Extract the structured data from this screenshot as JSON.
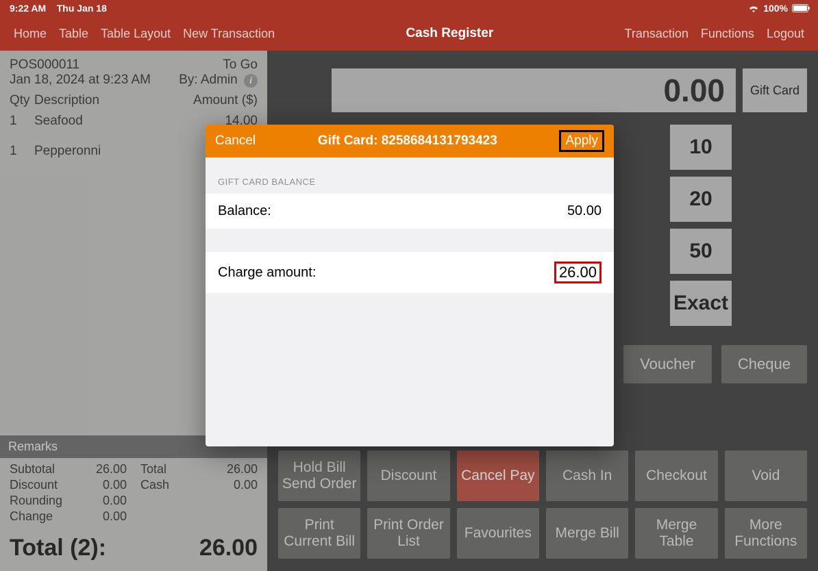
{
  "status": {
    "time": "9:22 AM",
    "date": "Thu Jan 18",
    "battery_pct": "100%"
  },
  "nav": {
    "left": [
      "Home",
      "Table",
      "Table Layout",
      "New Transaction"
    ],
    "title": "Cash Register",
    "right": [
      "Transaction",
      "Functions",
      "Logout"
    ]
  },
  "receipt": {
    "id": "POS000011",
    "type": "To Go",
    "dt": "Jan 18, 2024 at 9:23 AM",
    "by_label": "By: Admin",
    "cols": {
      "qty": "Qty",
      "desc": "Description",
      "amt": "Amount ($)"
    },
    "items": [
      {
        "qty": "1",
        "name": "Seafood",
        "amt": "14.00"
      },
      {
        "qty": "1",
        "name": "Pepperonni",
        "amt": ""
      }
    ],
    "remarks_label": "Remarks",
    "totals": {
      "subtotal_l": "Subtotal",
      "subtotal_v": "26.00",
      "total_l": "Total",
      "total_v": "26.00",
      "discount_l": "Discount",
      "discount_v": "0.00",
      "cash_l": "Cash",
      "cash_v": "0.00",
      "round_l": "Rounding",
      "round_v": "0.00",
      "change_l": "Change",
      "change_v": "0.00"
    },
    "grand_label": "Total (2):",
    "grand_value": "26.00"
  },
  "display": {
    "value": "0.00",
    "gift_label": "Gift Card"
  },
  "quick": [
    "10",
    "20",
    "50",
    "Exact"
  ],
  "pay_methods": {
    "voucher": "Voucher",
    "cheque": "Cheque"
  },
  "fn": {
    "hold": "Hold Bill Send Order",
    "discount": "Discount",
    "cancel_pay": "Cancel Pay",
    "cash_in": "Cash In",
    "checkout": "Checkout",
    "void": "Void",
    "print_current": "Print Current Bill",
    "print_list": "Print Order List",
    "favourites": "Favourites",
    "merge_bill": "Merge Bill",
    "merge_table": "Merge Table",
    "more": "More Functions"
  },
  "modal": {
    "cancel": "Cancel",
    "title": "Gift Card: 8258684131793423",
    "apply": "Apply",
    "section": "GIFT CARD BALANCE",
    "balance_l": "Balance:",
    "balance_v": "50.00",
    "charge_l": "Charge amount:",
    "charge_v": "26.00"
  }
}
